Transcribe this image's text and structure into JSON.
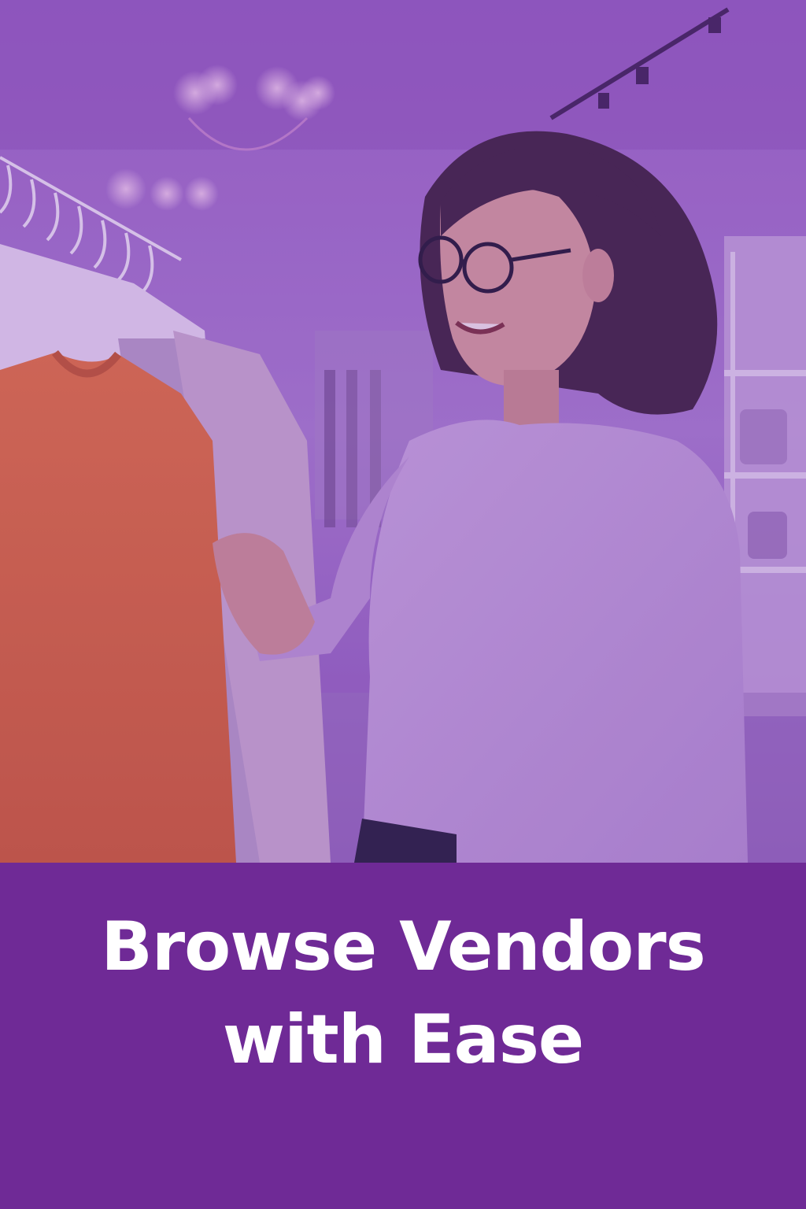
{
  "photo": {
    "scene": "woman-browsing-clothing-rack",
    "tint_color": "#9b5fc7"
  },
  "banner": {
    "background_color": "#6f2a96",
    "text_color": "#ffffff",
    "headline_line1": "Browse Vendors",
    "headline_line2": "with Ease"
  }
}
